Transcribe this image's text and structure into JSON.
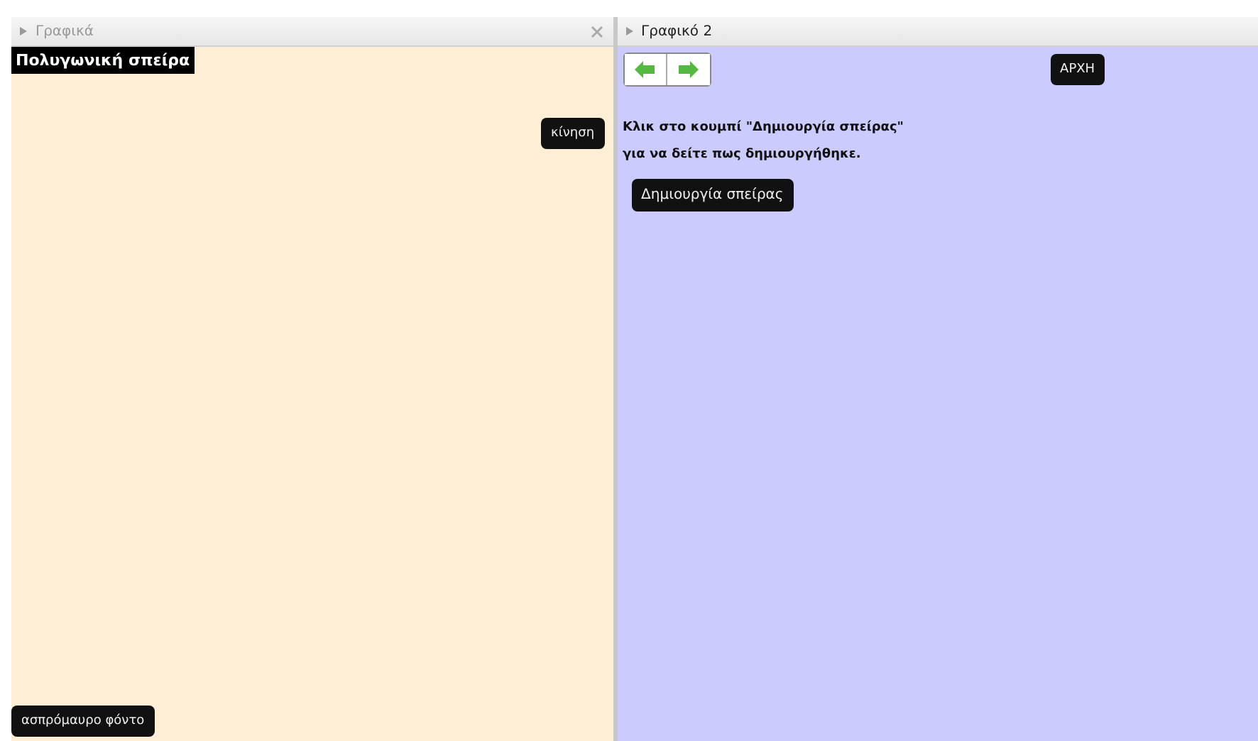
{
  "panels": [
    {
      "title": "Γραφικά",
      "active": false,
      "closable": true,
      "objects": [
        {
          "kind": "label",
          "text": "Πολυγωνική σπείρα"
        },
        {
          "kind": "button",
          "text": "κίνηση"
        },
        {
          "kind": "bottom-button",
          "text": "ασπρόμαυρο φόντο"
        }
      ]
    },
    {
      "title": "Γραφικό 2",
      "active": true,
      "closable": false,
      "objects": [
        {
          "kind": "nav"
        },
        {
          "kind": "button",
          "text": "ΑΡΧΗ"
        },
        {
          "kind": "text",
          "lines": [
            "Κλικ στο κουμπί \"Δημιουργία σπείρας\"",
            "για να δείτε πως δημιουργήθηκε."
          ]
        },
        {
          "kind": "text-button",
          "text": "Δημιουργία σπείρας"
        }
      ]
    }
  ]
}
